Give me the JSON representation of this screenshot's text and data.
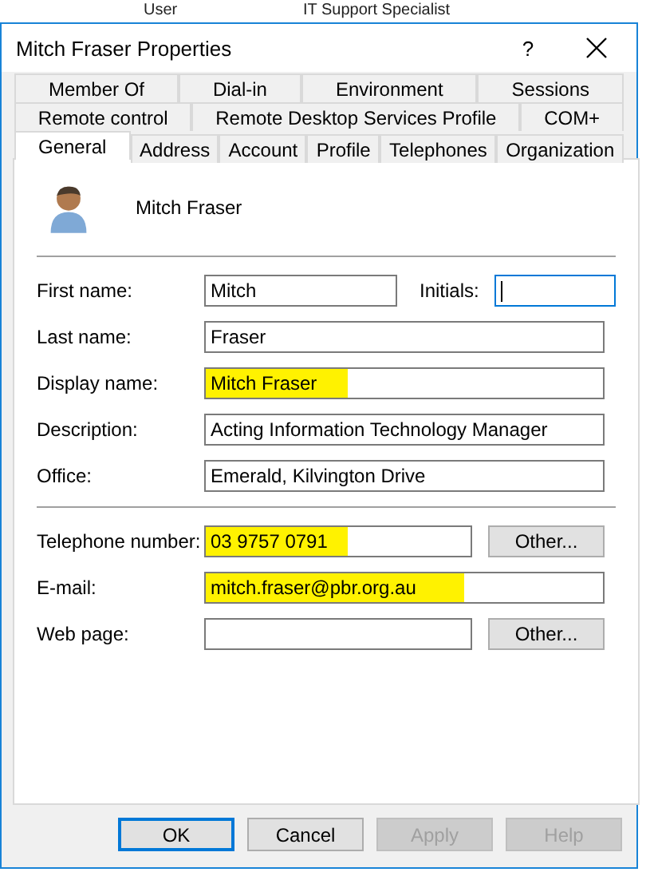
{
  "background_window": {
    "column_1": "User",
    "column_2": "IT Support Specialist"
  },
  "window": {
    "title": "Mitch Fraser Properties",
    "help": "?"
  },
  "tab_rows": [
    [
      {
        "label": "Member Of",
        "selected": false
      },
      {
        "label": "Dial-in",
        "selected": false
      },
      {
        "label": "Environment",
        "selected": false
      },
      {
        "label": "Sessions",
        "selected": false
      }
    ],
    [
      {
        "label": "Remote control",
        "selected": false
      },
      {
        "label": "Remote Desktop Services Profile",
        "selected": false
      },
      {
        "label": "COM+",
        "selected": false
      }
    ],
    [
      {
        "label": "General",
        "selected": true
      },
      {
        "label": "Address",
        "selected": false
      },
      {
        "label": "Account",
        "selected": false
      },
      {
        "label": "Profile",
        "selected": false
      },
      {
        "label": "Telephones",
        "selected": false
      },
      {
        "label": "Organization",
        "selected": false
      }
    ]
  ],
  "user": {
    "name": "Mitch Fraser"
  },
  "field_groups": [
    [
      {
        "kind": "pair",
        "label": "First name:",
        "value": "Mitch",
        "highlighted": false,
        "focused": false,
        "initials": {
          "label": "Initials:",
          "focused": true
        }
      },
      {
        "kind": "full",
        "label": "Last name:",
        "value": "Fraser",
        "highlighted": false,
        "focused": false
      },
      {
        "kind": "full",
        "label": "Display name:",
        "value": "Mitch Fraser",
        "highlighted": true,
        "focused": false
      },
      {
        "kind": "full",
        "label": "Description:",
        "value": "Acting Information Technology Manager",
        "highlighted": false,
        "focused": false
      },
      {
        "kind": "full",
        "label": "Office:",
        "value": "Emerald, Kilvington Drive",
        "highlighted": false,
        "focused": false
      }
    ],
    [
      {
        "kind": "button",
        "label": "Telephone number:",
        "value": "03 9757 0791",
        "highlighted": true,
        "focused": false,
        "button": "Other..."
      },
      {
        "kind": "full",
        "label": "E-mail:",
        "value": "mitch.fraser@pbr.org.au",
        "highlighted": true,
        "focused": false
      },
      {
        "kind": "button",
        "label": "Web page:",
        "highlighted": false,
        "focused": false,
        "button": "Other..."
      }
    ]
  ],
  "buttons": [
    {
      "label": "OK",
      "default": true,
      "disabled": false
    },
    {
      "label": "Cancel",
      "default": false,
      "disabled": false
    },
    {
      "label": "Apply",
      "default": false,
      "disabled": true
    },
    {
      "label": "Help",
      "default": false,
      "disabled": true
    }
  ]
}
